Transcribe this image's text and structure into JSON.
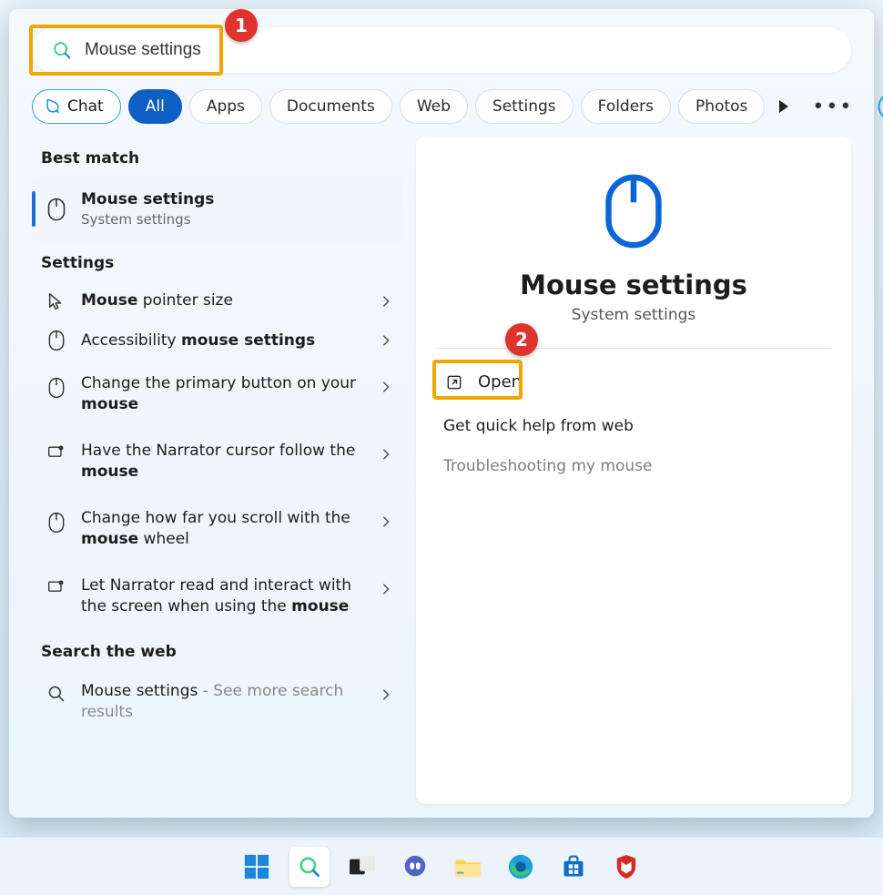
{
  "search": {
    "value": "Mouse settings"
  },
  "callouts": {
    "one": "1",
    "two": "2"
  },
  "chips": {
    "chat": "Chat",
    "items": [
      "All",
      "Apps",
      "Documents",
      "Web",
      "Settings",
      "Folders",
      "Photos"
    ],
    "active_index": 0
  },
  "sections": {
    "best_match": "Best match",
    "settings": "Settings",
    "search_web": "Search the web"
  },
  "best": {
    "title": "Mouse settings",
    "subtitle": "System settings"
  },
  "settings_items": [
    {
      "pre": "",
      "bold": "Mouse",
      "post": " pointer size"
    },
    {
      "pre": "Accessibility ",
      "bold": "mouse settings",
      "post": ""
    },
    {
      "pre": "Change the primary button on your ",
      "bold": "mouse",
      "post": ""
    },
    {
      "pre": "Have the Narrator cursor follow the ",
      "bold": "mouse",
      "post": ""
    },
    {
      "pre": "Change how far you scroll with the ",
      "bold": "mouse",
      "post": " wheel"
    },
    {
      "pre": "Let Narrator read and interact with the screen when using the ",
      "bold": "mouse",
      "post": ""
    }
  ],
  "web_item": {
    "title": "Mouse settings",
    "suffix": " - See more search results"
  },
  "preview": {
    "title": "Mouse settings",
    "subtitle": "System settings",
    "open": "Open",
    "help_header": "Get quick help from web",
    "help_link": "Troubleshooting my mouse"
  }
}
